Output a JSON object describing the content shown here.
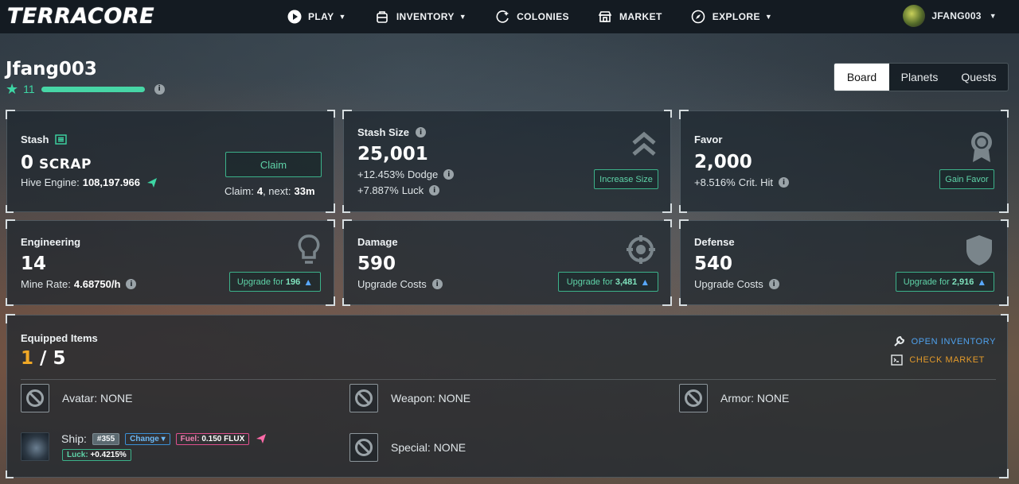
{
  "nav": {
    "logo": "TERRACORE",
    "items": [
      {
        "label": "PLAY",
        "icon": "play-icon",
        "has_caret": true
      },
      {
        "label": "INVENTORY",
        "icon": "backpack-icon",
        "has_caret": true
      },
      {
        "label": "COLONIES",
        "icon": "planet-icon",
        "has_caret": false
      },
      {
        "label": "MARKET",
        "icon": "store-icon",
        "has_caret": false
      },
      {
        "label": "EXPLORE",
        "icon": "compass-icon",
        "has_caret": true
      }
    ],
    "user": {
      "name": "JFANG003"
    }
  },
  "profile": {
    "name": "Jfang003",
    "level": "11",
    "xp_progress_percent": 100
  },
  "tabs": [
    {
      "label": "Board",
      "active": true
    },
    {
      "label": "Planets",
      "active": false
    },
    {
      "label": "Quests",
      "active": false
    }
  ],
  "stash": {
    "title": "Stash",
    "value": "0",
    "unit": "SCRAP",
    "hive_label": "Hive Engine:",
    "hive_value": "108,197.966",
    "claim_button": "Claim",
    "claim_label": "Claim:",
    "claim_count": "4",
    "claim_next_label": ", next:",
    "claim_next": "33m"
  },
  "stash_size": {
    "title": "Stash Size",
    "value": "25,001",
    "dodge_value": "+12.453%",
    "dodge_label": "Dodge",
    "luck_value": "+7.887%",
    "luck_label": "Luck",
    "button": "Increase Size"
  },
  "favor": {
    "title": "Favor",
    "value": "2,000",
    "crit_value": "+8.516%",
    "crit_label": "Crit. Hit",
    "button": "Gain Favor"
  },
  "engineering": {
    "title": "Engineering",
    "value": "14",
    "rate_label": "Mine Rate:",
    "rate_value": "4.68750/h",
    "upgrade_label": "Upgrade for",
    "upgrade_cost": "196"
  },
  "damage": {
    "title": "Damage",
    "value": "590",
    "sub_label": "Upgrade Costs",
    "upgrade_label": "Upgrade for",
    "upgrade_cost": "3,481"
  },
  "defense": {
    "title": "Defense",
    "value": "540",
    "sub_label": "Upgrade Costs",
    "upgrade_label": "Upgrade for",
    "upgrade_cost": "2,916"
  },
  "equipped": {
    "title": "Equipped Items",
    "count_current": "1",
    "count_sep": " / ",
    "count_total": "5",
    "open_inventory": "OPEN INVENTORY",
    "check_market": "CHECK MARKET",
    "slots": {
      "avatar": "Avatar: NONE",
      "weapon": "Weapon: NONE",
      "armor": "Armor: NONE",
      "special": "Special: NONE"
    },
    "ship": {
      "label": "Ship:",
      "id": "#355",
      "change": "Change",
      "fuel_label": "Fuel:",
      "fuel_value": "0.150 FLUX",
      "luck_label": "Luck:",
      "luck_value": "+0.4215%"
    }
  },
  "colors": {
    "accent_green": "#3dd6a4",
    "accent_orange": "#f0a826",
    "link_blue": "#58a8ff",
    "nav_bg": "#141b22"
  }
}
